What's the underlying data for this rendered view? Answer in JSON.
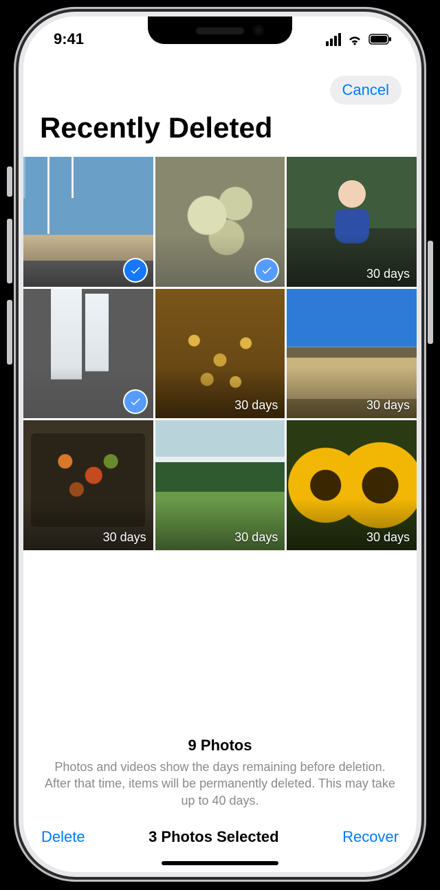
{
  "status": {
    "time": "9:41"
  },
  "nav": {
    "cancel": "Cancel"
  },
  "page": {
    "title": "Recently Deleted"
  },
  "grid": {
    "items": [
      {
        "selected": true,
        "days": ""
      },
      {
        "selected": true,
        "days": ""
      },
      {
        "selected": false,
        "days": "30 days"
      },
      {
        "selected": true,
        "days": ""
      },
      {
        "selected": false,
        "days": "30 days"
      },
      {
        "selected": false,
        "days": "30 days"
      },
      {
        "selected": false,
        "days": "30 days"
      },
      {
        "selected": false,
        "days": "30 days"
      },
      {
        "selected": false,
        "days": "30 days"
      }
    ]
  },
  "footer": {
    "count": "9 Photos",
    "explain": "Photos and videos show the days remaining before deletion. After that time, items will be permanently deleted. This may take up to 40 days."
  },
  "toolbar": {
    "delete": "Delete",
    "selected": "3 Photos Selected",
    "recover": "Recover"
  }
}
